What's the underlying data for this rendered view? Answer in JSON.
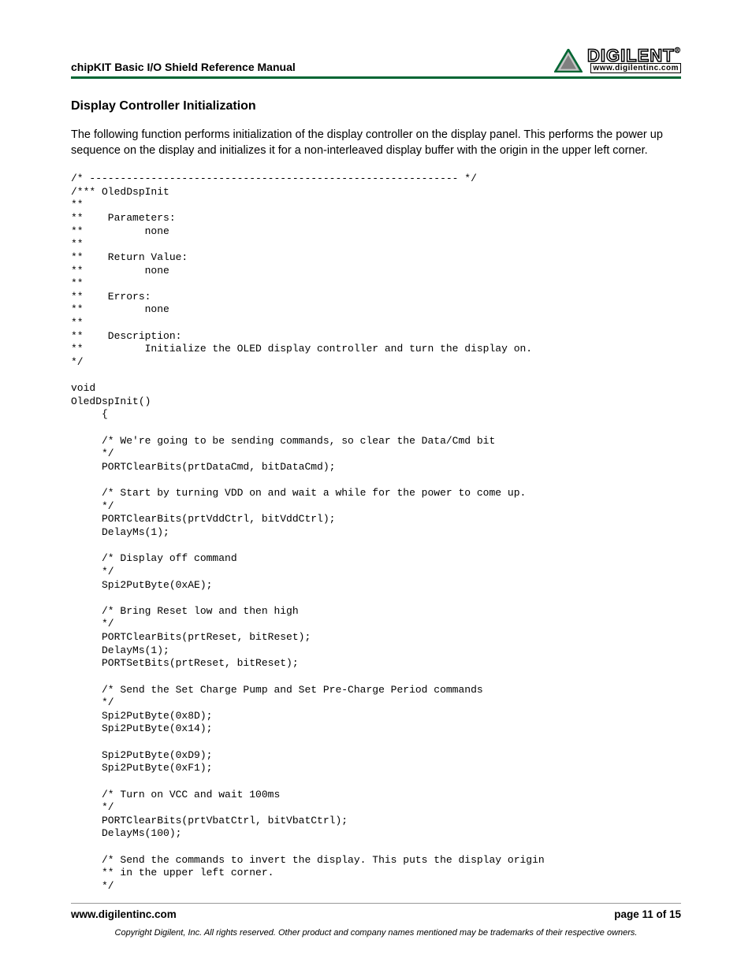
{
  "header": {
    "title": "chipKIT Basic I/O Shield Reference Manual",
    "logo": {
      "brand": "DIGILENT",
      "url": "www.digilentinc.com"
    }
  },
  "section": {
    "title": "Display Controller Initialization",
    "body": "The following function performs initialization of the display controller on the display panel. This performs the power up sequence on the display and initializes it for a non-interleaved display buffer with the origin in the upper left corner."
  },
  "code": "/* ------------------------------------------------------------ */\n/*** OledDspInit\n**\n**    Parameters:\n**          none\n**\n**    Return Value:\n**          none\n**\n**    Errors:\n**          none\n**\n**    Description:\n**          Initialize the OLED display controller and turn the display on.\n*/\n\nvoid\nOledDspInit()\n     {\n\n     /* We're going to be sending commands, so clear the Data/Cmd bit\n     */\n     PORTClearBits(prtDataCmd, bitDataCmd);\n\n     /* Start by turning VDD on and wait a while for the power to come up.\n     */\n     PORTClearBits(prtVddCtrl, bitVddCtrl);\n     DelayMs(1);\n\n     /* Display off command\n     */\n     Spi2PutByte(0xAE);\n\n     /* Bring Reset low and then high\n     */\n     PORTClearBits(prtReset, bitReset);\n     DelayMs(1);\n     PORTSetBits(prtReset, bitReset);\n\n     /* Send the Set Charge Pump and Set Pre-Charge Period commands\n     */\n     Spi2PutByte(0x8D);\n     Spi2PutByte(0x14);\n\n     Spi2PutByte(0xD9);\n     Spi2PutByte(0xF1);\n\n     /* Turn on VCC and wait 100ms\n     */\n     PORTClearBits(prtVbatCtrl, bitVbatCtrl);\n     DelayMs(100);\n\n     /* Send the commands to invert the display. This puts the display origin\n     ** in the upper left corner.\n     */",
  "footer": {
    "url": "www.digilentinc.com",
    "page": "page 11 of 15",
    "copyright": "Copyright Digilent, Inc. All rights reserved. Other product and company names mentioned may be trademarks of their respective owners."
  }
}
